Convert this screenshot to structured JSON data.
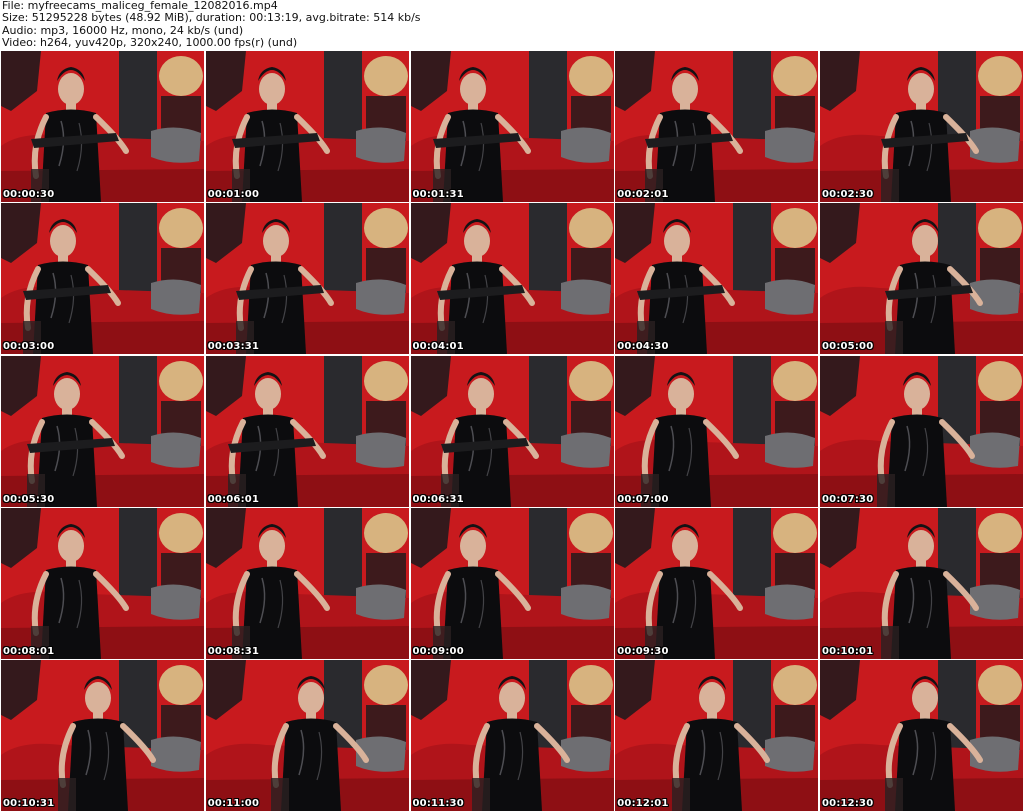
{
  "header": {
    "file_line": "File: myfreecams_maliceg_female_12082016.mp4",
    "size_line": "Size: 51295228 bytes (48.92 MiB), duration: 00:13:19, avg.bitrate: 514 kb/s",
    "audio_line": "Audio: mp3, 16000 Hz, mono, 24 kb/s (und)",
    "video_line": "Video: h264, yuv420p, 320x240, 1000.00 fps(r) (und)"
  },
  "thumbnails": [
    {
      "timestamp": "00:00:30"
    },
    {
      "timestamp": "00:01:00"
    },
    {
      "timestamp": "00:01:31"
    },
    {
      "timestamp": "00:02:01"
    },
    {
      "timestamp": "00:02:30"
    },
    {
      "timestamp": "00:03:00"
    },
    {
      "timestamp": "00:03:31"
    },
    {
      "timestamp": "00:04:01"
    },
    {
      "timestamp": "00:04:30"
    },
    {
      "timestamp": "00:05:00"
    },
    {
      "timestamp": "00:05:30"
    },
    {
      "timestamp": "00:06:01"
    },
    {
      "timestamp": "00:06:31"
    },
    {
      "timestamp": "00:07:00"
    },
    {
      "timestamp": "00:07:30"
    },
    {
      "timestamp": "00:08:01"
    },
    {
      "timestamp": "00:08:31"
    },
    {
      "timestamp": "00:09:00"
    },
    {
      "timestamp": "00:09:30"
    },
    {
      "timestamp": "00:10:01"
    },
    {
      "timestamp": "00:10:31"
    },
    {
      "timestamp": "00:11:00"
    },
    {
      "timestamp": "00:11:30"
    },
    {
      "timestamp": "00:12:01"
    },
    {
      "timestamp": "00:12:30"
    }
  ],
  "colors": {
    "wall_red": "#c81a1e",
    "sofa_red": "#b0141a",
    "wall_dark": "#2a2a2e",
    "cushion_gray": "#6e6e72",
    "outfit_black": "#0c0c0e",
    "skin": "#d9b29a",
    "timestamp_text": "#ffffff"
  }
}
